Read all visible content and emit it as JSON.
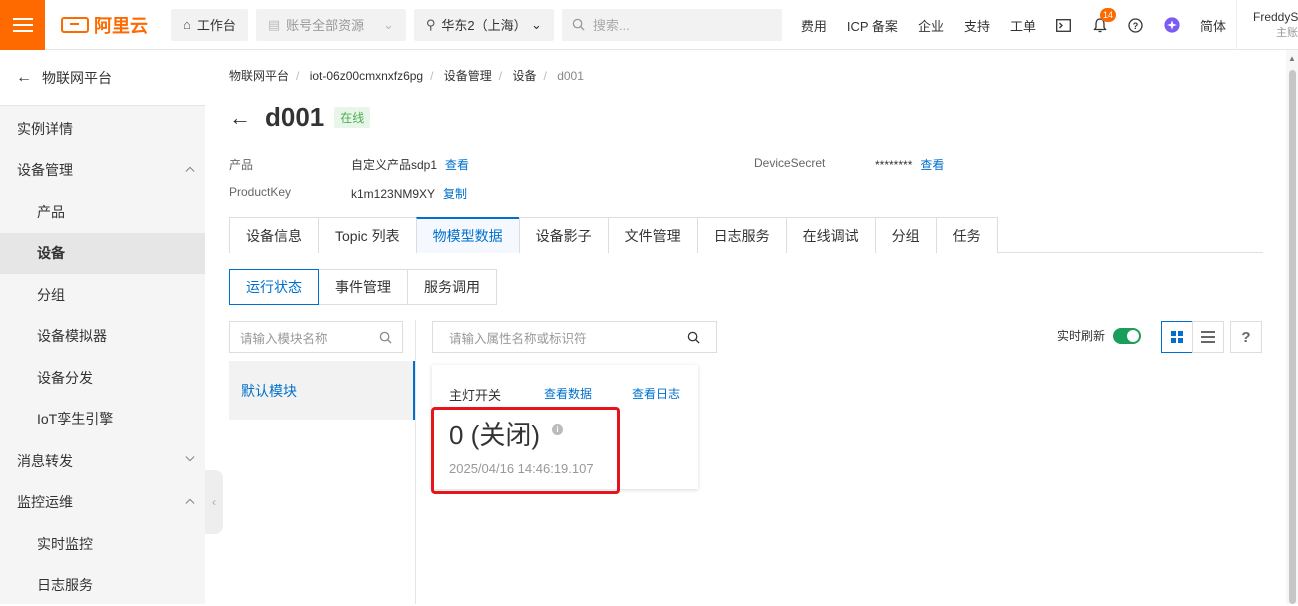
{
  "brand": {
    "logo_text": "阿里云"
  },
  "topbar": {
    "workbench": "工作台",
    "resources": "账号全部资源",
    "region": "华东2（上海）",
    "search_placeholder": "搜索...",
    "links": [
      "费用",
      "ICP 备案",
      "企业",
      "支持",
      "工单"
    ],
    "notification_count": "14",
    "language": "简体",
    "user_name": "FreddyS",
    "user_sub": "主账"
  },
  "sidebar": {
    "back_title": "物联网平台",
    "items": [
      {
        "label": "实例详情"
      },
      {
        "label": "设备管理"
      },
      {
        "label": "产品"
      },
      {
        "label": "设备"
      },
      {
        "label": "分组"
      },
      {
        "label": "设备模拟器"
      },
      {
        "label": "设备分发"
      },
      {
        "label": "IoT孪生引擎"
      },
      {
        "label": "消息转发"
      },
      {
        "label": "监控运维"
      },
      {
        "label": "实时监控"
      },
      {
        "label": "日志服务"
      }
    ]
  },
  "breadcrumb": [
    "物联网平台",
    "iot-06z00cmxnxfz6pg",
    "设备管理",
    "设备",
    "d001"
  ],
  "device": {
    "name": "d001",
    "status": "在线",
    "product_label": "产品",
    "product_value": "自定义产品sdp1",
    "product_link": "查看",
    "productkey_label": "ProductKey",
    "productkey_value": "k1m123NM9XY",
    "productkey_link": "复制",
    "secret_label": "DeviceSecret",
    "secret_value": "********",
    "secret_link": "查看"
  },
  "tabs": [
    "设备信息",
    "Topic 列表",
    "物模型数据",
    "设备影子",
    "文件管理",
    "日志服务",
    "在线调试",
    "分组",
    "任务"
  ],
  "subtabs": [
    "运行状态",
    "事件管理",
    "服务调用"
  ],
  "module_search_placeholder": "请输入模块名称",
  "module_default": "默认模块",
  "prop_search_placeholder": "请输入属性名称或标识符",
  "realtime_refresh": "实时刷新",
  "realtime_refresh_on": true,
  "help_label": "?",
  "card": {
    "name": "主灯开关",
    "view_data": "查看数据",
    "view_log": "查看日志",
    "value": "0 (关闭)",
    "info_icon": "i",
    "timestamp": "2025/04/16 14:46:19.107"
  },
  "colors": {
    "brand": "#ff6a00",
    "link": "#0070cc",
    "online": "#4caf50",
    "toggle": "#1a9e5b",
    "highlight": "#e5151b"
  }
}
